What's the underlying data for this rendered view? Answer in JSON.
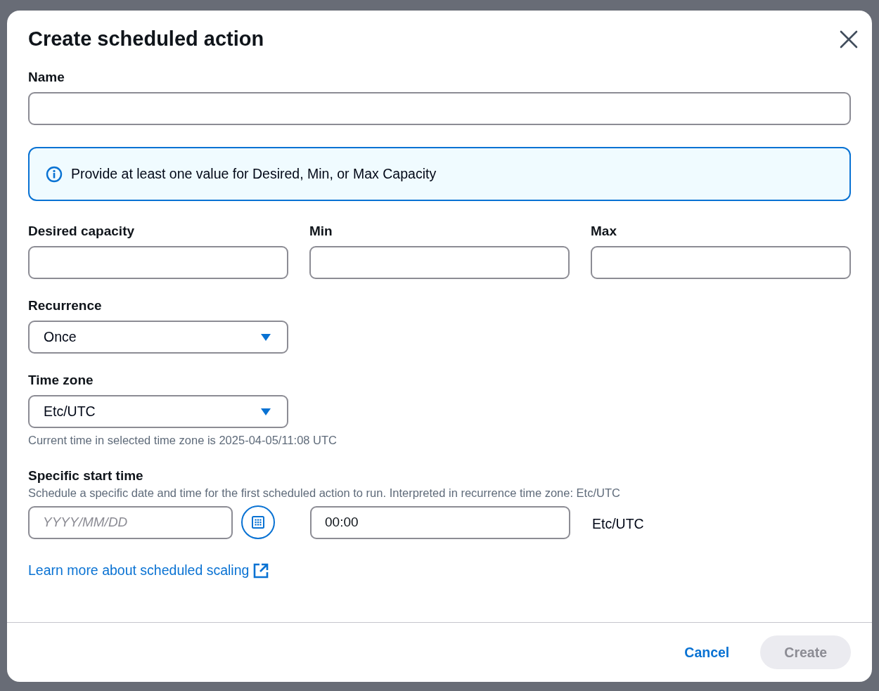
{
  "dialog": {
    "title": "Create scheduled action",
    "name_field": {
      "label": "Name"
    },
    "alert": {
      "text": "Provide at least one value for Desired, Min, or Max Capacity"
    },
    "capacity_fields": [
      {
        "label": "Desired capacity"
      },
      {
        "label": "Min"
      },
      {
        "label": "Max"
      }
    ],
    "recurrence": {
      "label": "Recurrence",
      "value": "Once"
    },
    "time_zone": {
      "label": "Time zone",
      "value": "Etc/UTC",
      "hint": "Current time in selected time zone is 2025-04-05/11:08 UTC"
    },
    "start_time": {
      "label": "Specific start time",
      "description": "Schedule a specific date and time for the first scheduled action to run. Interpreted in recurrence time zone: Etc/UTC",
      "date_placeholder": "YYYY/MM/DD",
      "time_value": "00:00",
      "zone": "Etc/UTC"
    },
    "learn_more_link": "Learn more about scheduled scaling",
    "buttons": [
      {
        "label": "Cancel",
        "kind": "link",
        "disabled": false
      },
      {
        "label": "Create",
        "kind": "primary",
        "disabled": true
      }
    ]
  }
}
